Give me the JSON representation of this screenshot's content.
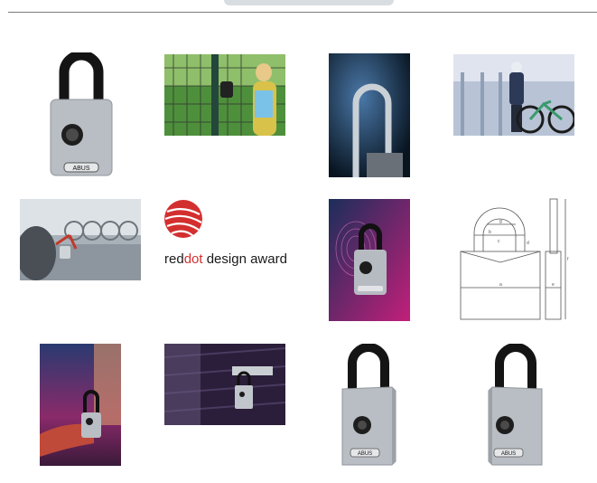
{
  "gallery": {
    "thumbnails": [
      {
        "name": "padlock-front-product",
        "brand": "ABUS"
      },
      {
        "name": "woman-fence-photo"
      },
      {
        "name": "shackle-closeup-photo"
      },
      {
        "name": "man-bike-photo"
      },
      {
        "name": "bike-rack-hand-photo"
      },
      {
        "name": "reddot-award-logo"
      },
      {
        "name": "fingerprint-pink-photo",
        "brand": "ABUS"
      },
      {
        "name": "dimension-drawing",
        "labels": [
          "a",
          "b",
          "c",
          "d",
          "e",
          "f",
          "g"
        ]
      },
      {
        "name": "hand-holding-lock-photo"
      },
      {
        "name": "hasp-door-photo"
      },
      {
        "name": "padlock-angle-left-product",
        "brand": "ABUS"
      },
      {
        "name": "padlock-angle-right-product",
        "brand": "ABUS"
      }
    ]
  },
  "award": {
    "red_part": "red",
    "dot_part": "dot",
    "rest": " design award"
  },
  "colors": {
    "accent_red": "#d32f2f",
    "lock_grey": "#b9bec4",
    "shackle_black": "#141414"
  }
}
